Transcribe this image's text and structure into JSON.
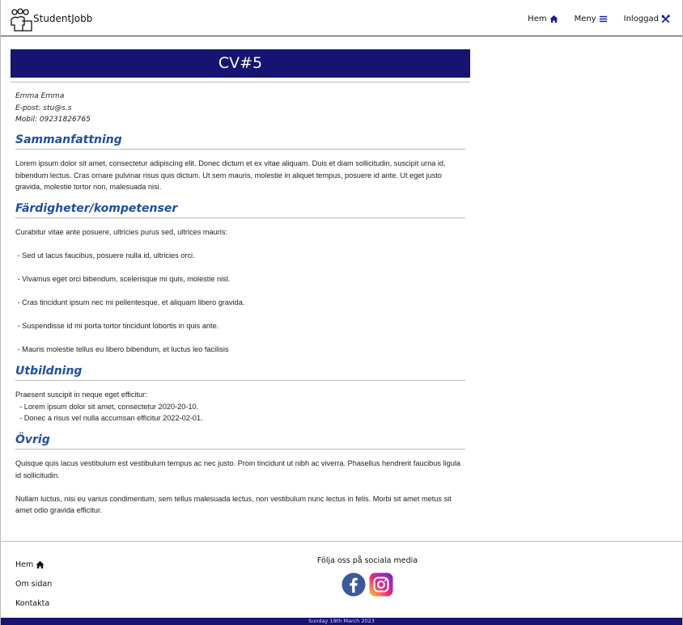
{
  "header": {
    "logo_text": "StudentJobb",
    "nav": [
      {
        "label": "Hem",
        "icon": "home-icon"
      },
      {
        "label": "Meny",
        "icon": "menu-icon"
      },
      {
        "label": "Inloggad",
        "icon": "tools-icon"
      }
    ]
  },
  "cv": {
    "title": "CV#5",
    "name": "Emma Emma",
    "email": "E-post: stu@s.s",
    "mobile": "Mobil: 09231826765"
  },
  "sections": {
    "summary": {
      "heading": "Sammanfattning",
      "text": "Lorem ipsum dolor sit amet, consectetur adipiscing elit. Donec dictum et ex vitae aliquam. Duis et diam sollicitudin, suscipit urna id, bibendum lectus. Cras ornare pulvinar risus quis dictum. Ut sem mauris, molestie in aliquet tempus, posuere id ante. Ut eget justo gravida, molestie tortor non, malesuada nisi."
    },
    "skills": {
      "heading": "Färdigheter/kompetenser",
      "intro": "Curabitur vitae ante posuere, ultricies purus sed, ultrices mauris:",
      "items": [
        " - Sed ut lacus faucibus, posuere nulla id, ultricies orci.",
        " - Vivamus eget orci bibendum, scelerisque mi quis, molestie nisl.",
        " - Cras tincidunt ipsum nec mi pellentesque, et aliquam libero gravida.",
        " - Suspendisse id mi porta tortor tincidunt lobortis in quis ante.",
        " - Mauris molestie tellus eu libero bibendum, et luctus leo facilisis"
      ]
    },
    "education": {
      "heading": "Utbildning",
      "lines": [
        "Praesent suscipit in neque eget efficitur:",
        "  - Lorem ipsum dolor sit amet, consectetur 2020-20-10.",
        "  - Donec a risus vel nulla accumsan efficitur 2022-02-01."
      ]
    },
    "other": {
      "heading": "Övrig",
      "paragraphs": [
        "Quisque quis lacus vestibulum est vestibulum tempus ac nec justo. Proin tincidunt ut nibh ac viverra. Phasellus hendrerit faucibus ligula id sollicitudin.",
        "Nullam luctus, nisi eu varius condimentum, sem tellus malesuada lectus, non vestibulum nunc lectus in felis. Morbi sit amet metus sit amet odio gravida efficitur."
      ]
    }
  },
  "footer": {
    "links": [
      {
        "label": "Hem",
        "icon": "home-icon"
      },
      {
        "label": "Om sidan"
      },
      {
        "label": "Kontakta"
      }
    ],
    "social_title": "Följa oss på sociala media",
    "social_icons": [
      "facebook-icon",
      "instagram-icon"
    ],
    "date": "Sunday 19th March 2023"
  },
  "colors": {
    "brand_navy": "#161470",
    "heading_blue": "#1f4fa3",
    "nav_icon_blue": "#1a1aa6"
  }
}
